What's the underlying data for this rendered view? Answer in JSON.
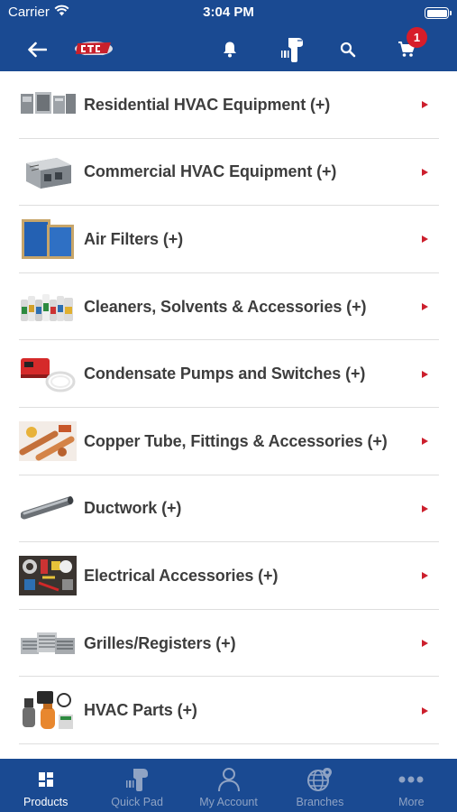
{
  "status": {
    "carrier": "Carrier",
    "time": "3:04 PM"
  },
  "navbar": {
    "cart_count": "1"
  },
  "categories": [
    {
      "label": "Residential HVAC Equipment (+)",
      "icon": "residential-hvac-icon"
    },
    {
      "label": "Commercial HVAC Equipment (+)",
      "icon": "commercial-hvac-icon"
    },
    {
      "label": "Air Filters (+)",
      "icon": "air-filter-icon"
    },
    {
      "label": "Cleaners, Solvents & Accessories (+)",
      "icon": "cleaners-icon"
    },
    {
      "label": "Condensate Pumps and Switches (+)",
      "icon": "condensate-pump-icon"
    },
    {
      "label": "Copper Tube, Fittings & Accessories (+)",
      "icon": "copper-tube-icon"
    },
    {
      "label": "Ductwork (+)",
      "icon": "ductwork-icon"
    },
    {
      "label": "Electrical Accessories (+)",
      "icon": "electrical-icon"
    },
    {
      "label": "Grilles/Registers (+)",
      "icon": "grilles-icon"
    },
    {
      "label": "HVAC Parts (+)",
      "icon": "hvac-parts-icon"
    }
  ],
  "tabs": [
    {
      "label": "Products",
      "icon": "grid-icon"
    },
    {
      "label": "Quick Pad",
      "icon": "scanner-icon"
    },
    {
      "label": "My Account",
      "icon": "person-icon"
    },
    {
      "label": "Branches",
      "icon": "globe-icon"
    },
    {
      "label": "More",
      "icon": "more-icon"
    }
  ],
  "colors": {
    "brand_blue": "#1a4a92",
    "accent_red": "#cc1f2d",
    "badge_red": "#d71d2a"
  }
}
